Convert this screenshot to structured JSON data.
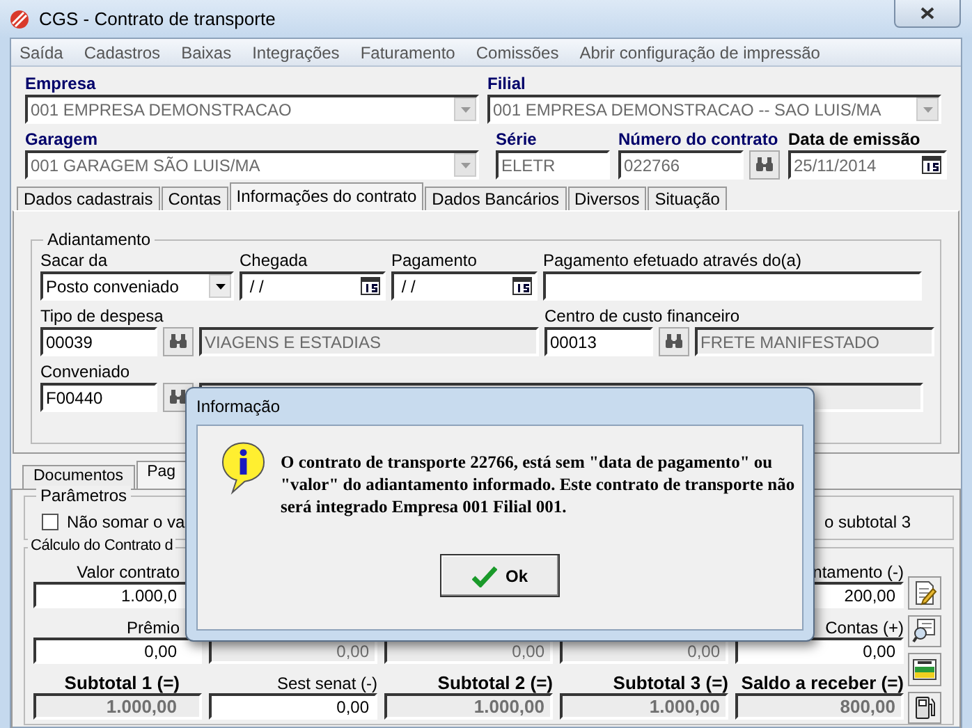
{
  "window": {
    "title": "CGS - Contrato de transporte"
  },
  "menu": [
    "Saída",
    "Cadastros",
    "Baixas",
    "Integrações",
    "Faturamento",
    "Comissões",
    "Abrir configuração de impressão"
  ],
  "header": [
    {
      "label": "Empresa",
      "value": "001 EMPRESA DEMONSTRACAO",
      "kind": "combo",
      "required": true,
      "disabled": true
    },
    {
      "label": "Filial",
      "value": "001 EMPRESA DEMONSTRACAO -- SAO LUIS/MA",
      "kind": "combo",
      "required": true,
      "disabled": true
    },
    {
      "label": "Garagem",
      "value": "001 GARAGEM SÃO LUIS/MA",
      "kind": "combo",
      "required": true,
      "disabled": true
    },
    {
      "label": "Série",
      "value": "ELETR",
      "kind": "text",
      "required": true,
      "disabled": true
    },
    {
      "label": "Número do contrato",
      "value": "022766",
      "kind": "lookup",
      "required": true,
      "disabled": true
    },
    {
      "label": "Data de emissão",
      "value": "25/11/2014",
      "kind": "date",
      "required": false,
      "disabled": true
    }
  ],
  "tabs": [
    {
      "label": "Dados cadastrais",
      "selected": false
    },
    {
      "label": "Contas",
      "selected": false
    },
    {
      "label": "Informações do contrato",
      "selected": true
    },
    {
      "label": "Dados Bancários",
      "selected": false
    },
    {
      "label": "Diversos",
      "selected": false
    },
    {
      "label": "Situação",
      "selected": false
    }
  ],
  "advance": {
    "title": "Adiantamento",
    "fields": [
      {
        "label": "Sacar da",
        "kind": "select",
        "value": "Posto conveniado"
      },
      {
        "label": "Chegada",
        "kind": "date",
        "value": "/ /"
      },
      {
        "label": "Pagamento",
        "kind": "date",
        "value": "/ /"
      },
      {
        "label": "Pagamento efetuado através do(a)",
        "kind": "text"
      },
      {
        "label": "Tipo de despesa",
        "kind": "lookup",
        "value": "00039",
        "description": "VIAGENS E ESTADIAS"
      },
      {
        "label": "Centro de custo financeiro",
        "kind": "lookup",
        "value": "00013",
        "description": "FRETE MANIFESTADO"
      },
      {
        "label": "Conveniado",
        "kind": "lookup",
        "value": "F00440"
      }
    ]
  },
  "lower_tabs": [
    {
      "label": "Documentos",
      "selected": false
    },
    {
      "label": "Pag",
      "selected": true
    }
  ],
  "parameters": {
    "title": "Parâmetros",
    "checkbox": {
      "label": "Não somar o va",
      "checked": false
    },
    "note": "o subtotal 3"
  },
  "calculation": {
    "title": "Cálculo do Contrato d",
    "rows": [
      [
        {
          "label": "Valor contrato",
          "value": "1.000,0",
          "disabled": false,
          "bold": false
        },
        null,
        null,
        null,
        {
          "label": "ntamento (-)",
          "value": "200,00",
          "disabled": false,
          "bold": false
        }
      ],
      [
        {
          "label": "Prêmio",
          "value": "0,00",
          "disabled": false,
          "bold": false
        },
        {
          "value": "0,00",
          "disabled": true,
          "bold": false
        },
        {
          "value": "0,00",
          "disabled": true,
          "bold": false
        },
        {
          "value": "0,00",
          "disabled": true,
          "bold": false
        },
        {
          "label": "Contas (+)",
          "value": "0,00",
          "disabled": false,
          "bold": false
        }
      ],
      [
        {
          "label": "Subtotal 1 (=)",
          "value": "1.000,00",
          "disabled": true,
          "bold": true
        },
        {
          "label": "Sest senat (-)",
          "value": "0,00",
          "disabled": false,
          "bold": false
        },
        {
          "label": "Subtotal 2 (=)",
          "value": "1.000,00",
          "disabled": true,
          "bold": true
        },
        {
          "label": "Subtotal 3 (=)",
          "value": "1.000,00",
          "disabled": true,
          "bold": true
        },
        {
          "label": "Saldo a receber (=)",
          "value": "800,00",
          "disabled": true,
          "bold": true
        }
      ]
    ]
  },
  "tools": [
    {
      "kind": "edit"
    },
    {
      "kind": "search"
    },
    {
      "kind": "card"
    },
    {
      "kind": "fuel"
    }
  ],
  "dialog": {
    "title": "Informação",
    "message": "O contrato de transporte 22766, está sem \"data de pagamento\" ou \"valor\" do adiantamento informado. Este contrato de transporte não será integrado Empresa 001 Filial 001.",
    "button": "Ok"
  }
}
